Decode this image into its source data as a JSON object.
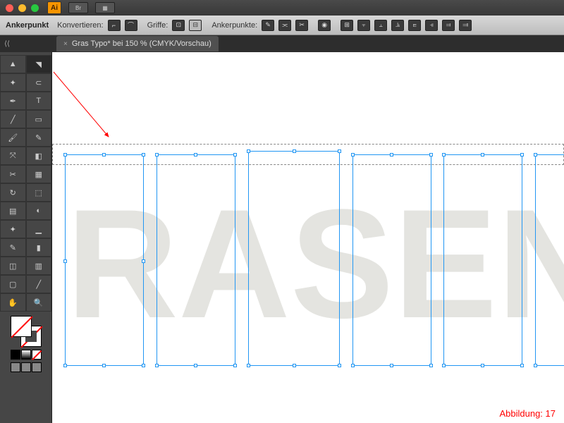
{
  "titlebar": {
    "app_abbrev": "Ai",
    "btn1": "Br",
    "btn2": "▦"
  },
  "controlbar": {
    "anchor_label": "Ankerpunkt",
    "convert_label": "Konvertieren:",
    "handles_label": "Griffe:",
    "anchors_label": "Ankerpunkte:"
  },
  "tab": {
    "close": "×",
    "title": "Gras Typo* bei 150 % (CMYK/Vorschau)"
  },
  "tools": {
    "r0c0": "▲",
    "r0c1": "◥",
    "r1c0": "✦",
    "r1c1": "⊂",
    "r2c0": "✒",
    "r2c1": "T",
    "r3c0": "╱",
    "r3c1": "▭",
    "r4c0": "🖌",
    "r4c1": "✎",
    "r5c0": "⤧",
    "r5c1": "◧",
    "r6c0": "✂",
    "r6c1": "▦",
    "r7c0": "↻",
    "r7c1": "⬚",
    "r8c0": "▤",
    "r8c1": "◐",
    "r9c0": "✦",
    "r9c1": "▁",
    "r10c0": "✎",
    "r10c1": "▮",
    "r11c0": "◫",
    "r11c1": "▥",
    "r12c0": "▢",
    "r12c1": "╱",
    "r13c0": "✋",
    "r13c1": "🔍"
  },
  "canvas": {
    "text": "RASEN"
  },
  "caption": "Abbildung: 17"
}
